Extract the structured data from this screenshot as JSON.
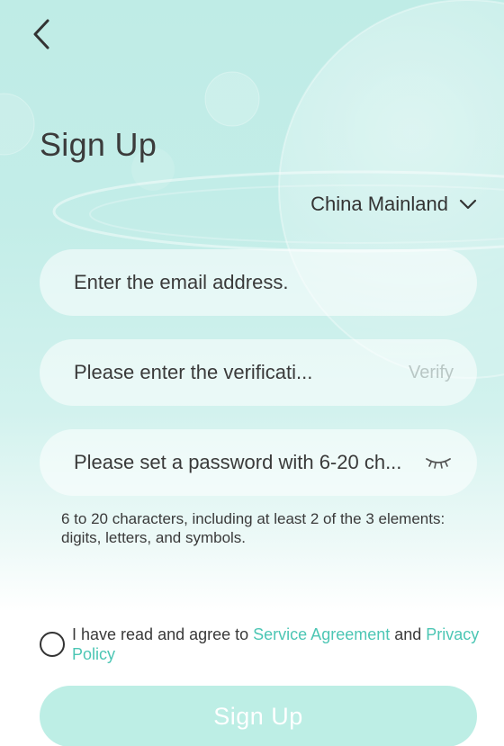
{
  "header": {
    "back_icon": "chevron-left-icon",
    "title": "Sign Up"
  },
  "region": {
    "value": "China Mainland",
    "icon": "chevron-down-icon"
  },
  "form": {
    "email_placeholder": "Enter the email address.",
    "email_value": "",
    "code_placeholder": "Please enter the verificati...",
    "code_value": "",
    "verify_label": "Verify",
    "password_placeholder": "Please set a password with 6-20 ch...",
    "password_value": "",
    "password_toggle_icon": "eye-closed-icon",
    "password_hint": "6 to 20 characters, including at least 2 of the 3 elements: digits, letters, and symbols."
  },
  "agreement": {
    "checked": false,
    "prefix": "I have read and agree to ",
    "service_link": "Service Agreement",
    "conjunction": " and ",
    "privacy_link": "Privacy Policy"
  },
  "submit": {
    "label": "Sign Up"
  },
  "colors": {
    "accent": "#4cc6b4",
    "button_bg": "#bdeee5",
    "background_top": "#bfece6",
    "text": "#3a3a3a",
    "verify_disabled": "#b9c7c5"
  }
}
